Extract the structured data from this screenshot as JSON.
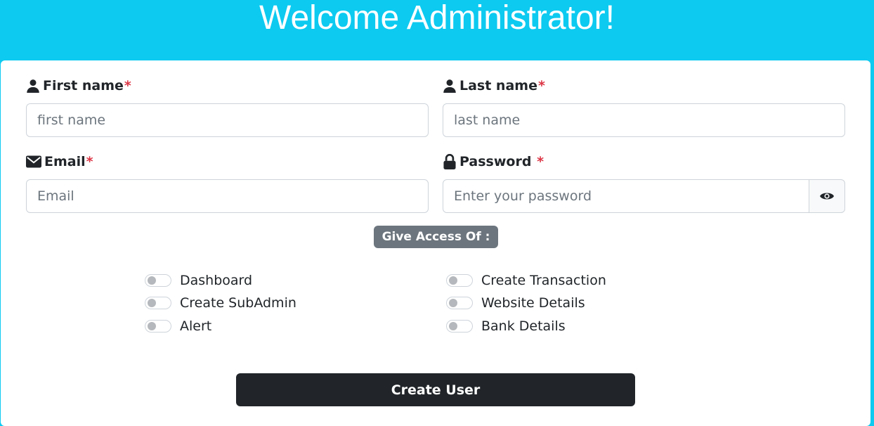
{
  "header": {
    "title": "Welcome Administrator!"
  },
  "form": {
    "first_name": {
      "label": "First name",
      "required": "*",
      "placeholder": "first name",
      "icon": "user-icon"
    },
    "last_name": {
      "label": "Last name",
      "required": "*",
      "placeholder": "last name",
      "icon": "user-icon"
    },
    "email": {
      "label": "Email",
      "required": "*",
      "placeholder": "Email",
      "icon": "envelope-icon"
    },
    "password": {
      "label": "Password",
      "required": "*",
      "placeholder": "Enter your password",
      "icon": "lock-icon",
      "toggle_icon": "eye-icon"
    },
    "access_title": "Give Access Of :",
    "access_items_left": [
      "Dashboard",
      "Create SubAdmin",
      "Alert"
    ],
    "access_items_right": [
      "Create Transaction",
      "Website Details",
      "Bank Details"
    ],
    "submit_label": "Create User"
  },
  "colors": {
    "header_bg": "#0dcaf0",
    "required": "#dc3545",
    "badge_bg": "#6c757d",
    "button_bg": "#212529"
  }
}
